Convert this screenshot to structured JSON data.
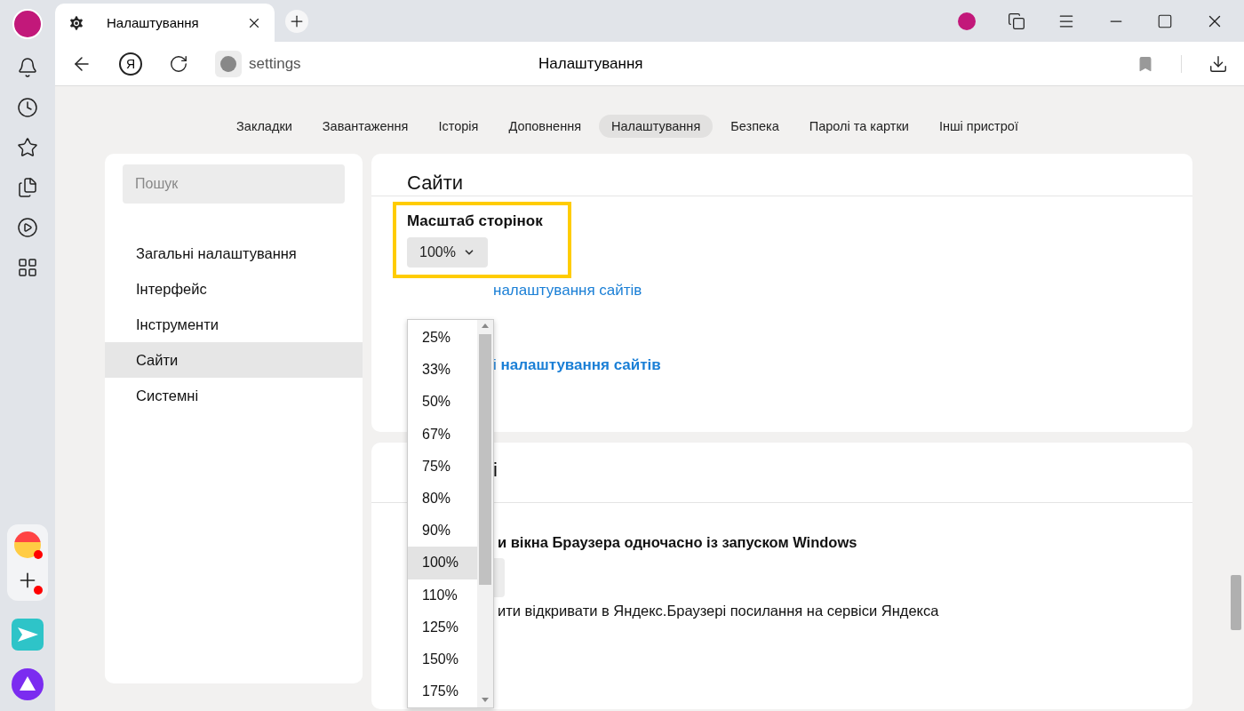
{
  "tab": {
    "title": "Налаштування"
  },
  "toolbar": {
    "home_button": "Я",
    "address": "settings",
    "page_title": "Налаштування"
  },
  "nav_tabs": [
    {
      "label": "Закладки",
      "selected": false
    },
    {
      "label": "Завантаження",
      "selected": false
    },
    {
      "label": "Історія",
      "selected": false
    },
    {
      "label": "Доповнення",
      "selected": false
    },
    {
      "label": "Налаштування",
      "selected": true
    },
    {
      "label": "Безпека",
      "selected": false
    },
    {
      "label": "Паролі та картки",
      "selected": false
    },
    {
      "label": "Інші пристрої",
      "selected": false
    }
  ],
  "search": {
    "placeholder": "Пошук"
  },
  "menu": [
    {
      "label": "Загальні налаштування",
      "selected": false
    },
    {
      "label": "Інтерфейс",
      "selected": false
    },
    {
      "label": "Інструменти",
      "selected": false
    },
    {
      "label": "Сайти",
      "selected": true
    },
    {
      "label": "Системні",
      "selected": false
    }
  ],
  "sites_card": {
    "title": "Сайти",
    "zoom_label": "Масштаб сторінок",
    "zoom_value": "100%",
    "link_1": "налаштування сайтів",
    "link_2": "і **налаштування сайтів**"
  },
  "system_card": {
    "title": "і",
    "option_1": "и вікна Браузера одночасно із запуском Windows",
    "option_2": "ити відкривати в Яндекс.Браузері посилання на сервіси Яндекса"
  },
  "zoom_dropdown": [
    {
      "label": "25%",
      "selected": false
    },
    {
      "label": "33%",
      "selected": false
    },
    {
      "label": "50%",
      "selected": false
    },
    {
      "label": "67%",
      "selected": false
    },
    {
      "label": "75%",
      "selected": false
    },
    {
      "label": "80%",
      "selected": false
    },
    {
      "label": "90%",
      "selected": false
    },
    {
      "label": "100%",
      "selected": true
    },
    {
      "label": "110%",
      "selected": false
    },
    {
      "label": "125%",
      "selected": false
    },
    {
      "label": "150%",
      "selected": false
    },
    {
      "label": "175%",
      "selected": false
    }
  ]
}
